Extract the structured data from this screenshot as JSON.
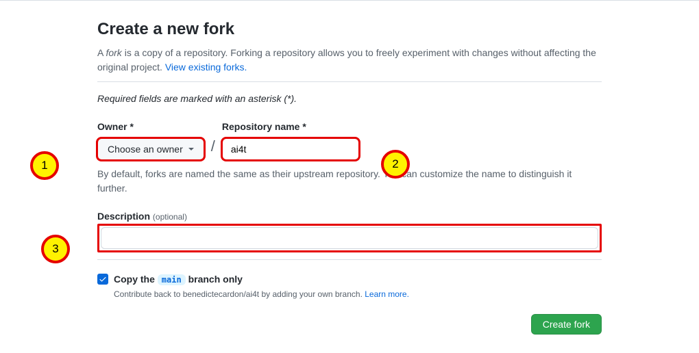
{
  "heading": "Create a new fork",
  "subtitle": {
    "pre": "A ",
    "em": "fork",
    "mid": " is a copy of a repository. Forking a repository allows you to freely experiment with changes without affecting the original project. ",
    "link": "View existing forks."
  },
  "required_note": "Required fields are marked with an asterisk (*).",
  "owner": {
    "label": "Owner *",
    "selected": "Choose an owner"
  },
  "slash": "/",
  "repo": {
    "label": "Repository name *",
    "value": "ai4t"
  },
  "name_help": "By default, forks are named the same as their upstream repository. You can customize the name to distinguish it further.",
  "description": {
    "label": "Description ",
    "optional": "(optional)",
    "value": ""
  },
  "copy_branch": {
    "pre": "Copy the ",
    "branch": "main",
    "post": " branch only",
    "help_pre": "Contribute back to benedictecardon/ai4t by adding your own branch. ",
    "help_link": "Learn more."
  },
  "submit": "Create fork",
  "badges": {
    "b1": "1",
    "b2": "2",
    "b3": "3"
  }
}
